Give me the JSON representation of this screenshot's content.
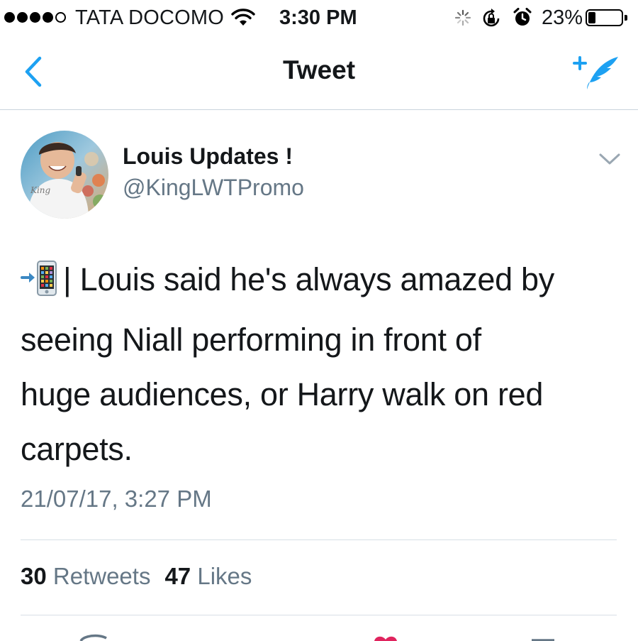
{
  "status_bar": {
    "carrier": "TATA DOCOMO",
    "time": "3:30 PM",
    "battery_percent": "23%",
    "battery_level": 0.23,
    "signal_bars_filled": 4,
    "signal_bars_total": 5,
    "icons": [
      "signal-dots-icon",
      "wifi-icon",
      "activity-spinner-icon",
      "rotation-lock-icon",
      "alarm-icon",
      "battery-icon"
    ]
  },
  "nav": {
    "title": "Tweet",
    "back_icon": "chevron-left-icon",
    "compose_icon": "compose-quill-icon"
  },
  "tweet": {
    "author": {
      "display_name": "Louis Updates !",
      "handle": "@KingLWTPromo"
    },
    "text_lines": [
      "| Louis said he's always amazed by",
      "seeing Niall performing in front of",
      "huge audiences, or Harry walk on red",
      "carpets."
    ],
    "text_emoji": "mobile-phone-arrow-icon",
    "timestamp": "21/07/17, 3:27 PM",
    "stats": {
      "retweets_count": "30",
      "retweets_label": "Retweets",
      "likes_count": "47",
      "likes_label": "Likes"
    }
  },
  "colors": {
    "accent": "#1da1f2",
    "text": "#14171a",
    "secondary": "#657786",
    "divider": "#d7dfe6",
    "like_pink": "#e0245e"
  }
}
